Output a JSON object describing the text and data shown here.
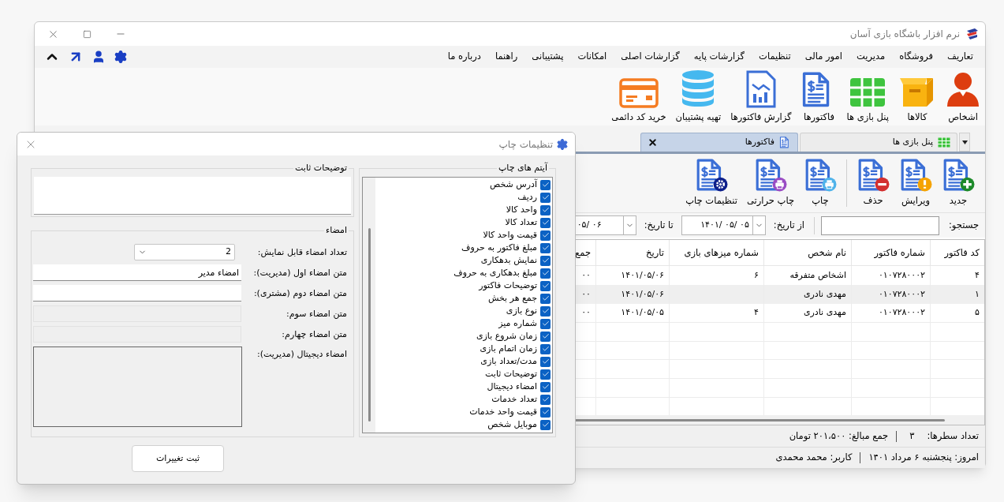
{
  "main_window": {
    "title": "نرم افزار باشگاه بازی آسان",
    "menu": [
      "تعاریف",
      "فروشگاه",
      "مدیریت",
      "امور مالی",
      "تنظیمات",
      "گزارشات پایه",
      "گزارشات اصلی",
      "امکانات",
      "پشتیبانی",
      "راهنما",
      "درباره ما"
    ],
    "ribbon": [
      {
        "label": "اشخاص",
        "kind": "person"
      },
      {
        "label": "کالاها",
        "kind": "box"
      },
      {
        "label": "پنل بازی ها",
        "kind": "grid"
      },
      {
        "label": "فاکتورها",
        "kind": "invoice"
      },
      {
        "label": "گزارش فاکتورها",
        "kind": "report"
      },
      {
        "label": "تهیه پشتیبان",
        "kind": "database"
      },
      {
        "label": "خرید کد دائمی",
        "kind": "card"
      }
    ],
    "tabs": [
      {
        "label": "پنل بازی ها",
        "kind": "grid",
        "selected": false
      },
      {
        "label": "فاکتورها",
        "kind": "invoice",
        "selected": true
      }
    ],
    "toolbar_groups": [
      [
        {
          "label": "جدید",
          "kind": "add"
        },
        {
          "label": "ویرایش",
          "kind": "edit"
        },
        {
          "label": "حذف",
          "kind": "delete"
        }
      ],
      [
        {
          "label": "چاپ",
          "kind": "print"
        },
        {
          "label": "چاپ حرارتی",
          "kind": "thermal"
        },
        {
          "label": "تنظیمات چاپ",
          "kind": "settings"
        }
      ]
    ],
    "filters": {
      "search_label": "جستجو:",
      "from_label": "از تاریخ:",
      "from_value": "۱۴۰۱/ ۰۵/ ۰۵",
      "to_label": "تا تاریخ:",
      "to_value": "۰۵/ ۰۶"
    },
    "table": {
      "columns": [
        "کد فاکتور",
        "شماره فاکتور",
        "نام شخص",
        "شماره میزهای بازی",
        "تاریخ",
        "جمع"
      ],
      "rows": [
        {
          "cells": [
            "۴",
            "۰۱۰۷۲۸۰۰۰۲",
            "اشخاص متفرقه",
            "۶",
            "۱۴۰۱/۰۵/۰۶",
            "۰۰"
          ],
          "selected": false
        },
        {
          "cells": [
            "۱",
            "۰۱۰۷۲۸۰۰۰۲",
            "مهدی نادری",
            "",
            "۱۴۰۱/۰۵/۰۶",
            "۰۰"
          ],
          "selected": true
        },
        {
          "cells": [
            "۵",
            "۰۱۰۷۲۸۰۰۰۲",
            "مهدی نادری",
            "۴",
            "۱۴۰۱/۰۵/۰۵",
            "۰۰"
          ],
          "selected": false
        }
      ]
    },
    "status": {
      "row_count_label": "تعداد سطرها:",
      "row_count": "۳",
      "total": "جمع مبالغ: ۲۰۱،۵۰۰ تومان"
    },
    "footer": {
      "today": "امروز: پنجشنبه ۶ مرداد ۱۴۰۱",
      "user": "کاربر: محمد محمدی"
    }
  },
  "dialog": {
    "title": "تنظیمات چاپ",
    "notes_group": "توضیحات ثابت",
    "signature_group": "امضاء",
    "fields": [
      {
        "label": "تعداد امضاء قابل نمایش:",
        "kind": "select",
        "value": "2",
        "disabled": false
      },
      {
        "label": "متن امضاء اول (مدیریت):",
        "kind": "text",
        "value": "امضاء مدیر",
        "disabled": false
      },
      {
        "label": "متن امضاء دوم (مشتری):",
        "kind": "text",
        "disabled": false
      },
      {
        "label": "متن امضاء سوم:",
        "kind": "text",
        "disabled": true
      },
      {
        "label": "متن امضاء چهارم:",
        "kind": "text",
        "disabled": true
      },
      {
        "label": "امضاء دیجیتال (مدیریت):",
        "kind": "image",
        "disabled": false
      }
    ],
    "items_group": "آیتم های چاپ",
    "items": [
      {
        "label": "آدرس شخص",
        "checked": true
      },
      {
        "label": "ردیف",
        "checked": true
      },
      {
        "label": "واحد کالا",
        "checked": true
      },
      {
        "label": "تعداد کالا",
        "checked": true
      },
      {
        "label": "قیمت واحد کالا",
        "checked": true
      },
      {
        "label": "مبلغ فاکتور به حروف",
        "checked": true
      },
      {
        "label": "نمایش بدهکاری",
        "checked": true
      },
      {
        "label": "مبلغ بدهکاری به حروف",
        "checked": true
      },
      {
        "label": "توضیحات فاکتور",
        "checked": true
      },
      {
        "label": "جمع هر بخش",
        "checked": true
      },
      {
        "label": "نوع بازی",
        "checked": true
      },
      {
        "label": "شماره میز",
        "checked": true
      },
      {
        "label": "زمان شروع بازی",
        "checked": true
      },
      {
        "label": "زمان اتمام بازی",
        "checked": true
      },
      {
        "label": "مدت/تعداد بازی",
        "checked": true
      },
      {
        "label": "توضیحات ثابت",
        "checked": true
      },
      {
        "label": "امضاء دیجیتال",
        "checked": true
      },
      {
        "label": "تعداد خدمات",
        "checked": true
      },
      {
        "label": "قیمت واحد خدمات",
        "checked": true
      },
      {
        "label": "موبایل شخص",
        "checked": true
      }
    ],
    "save_button": "ثبت تغییرات"
  }
}
